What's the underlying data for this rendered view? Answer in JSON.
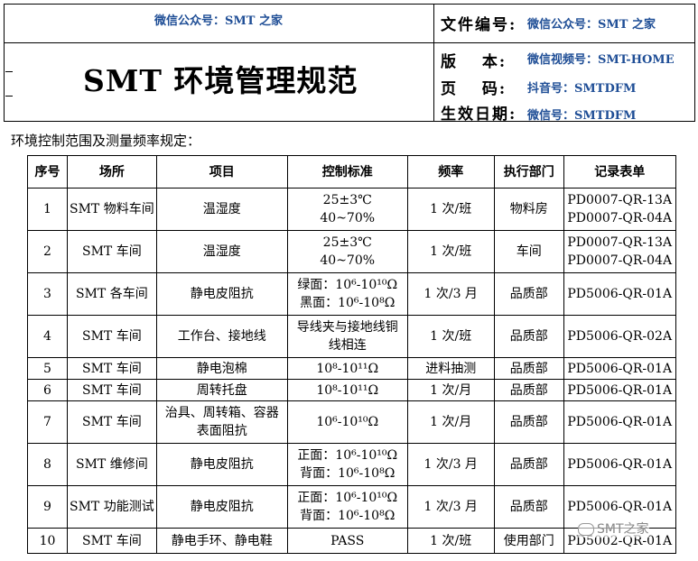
{
  "header": {
    "top_left_text": "微信公众号：SMT 之家",
    "title": "SMT 环境管理规范",
    "meta": [
      {
        "label": "文件编号:",
        "value": "微信公众号：SMT 之家"
      },
      {
        "label": "版　 本:",
        "value": "微信视频号：SMT-HOME"
      },
      {
        "label": "页　 码:",
        "value": "抖音号：SMTDFM"
      },
      {
        "label": "生效日期:",
        "value": "微信号：SMTDFM"
      }
    ]
  },
  "section_title": "环境控制范围及测量频率规定：",
  "table": {
    "headers": [
      "序号",
      "场所",
      "项目",
      "控制标准",
      "频率",
      "执行部门",
      "记录表单"
    ],
    "rows": [
      {
        "no": "1",
        "place": "SMT 物料车间",
        "item": "温湿度",
        "standard": [
          "25±3℃",
          "40~70%"
        ],
        "freq": "1 次/班",
        "dept": "物料房",
        "record": [
          "PD0007-QR-13A",
          "PD0007-QR-04A"
        ]
      },
      {
        "no": "2",
        "place": "SMT 车间",
        "item": "温湿度",
        "standard": [
          "25±3℃",
          "40~70%"
        ],
        "freq": "1 次/班",
        "dept": "车间",
        "record": [
          "PD0007-QR-13A",
          "PD0007-QR-04A"
        ]
      },
      {
        "no": "3",
        "place": "SMT 各车间",
        "item": "静电皮阻抗",
        "standard": [
          "绿面：10⁶-10¹⁰Ω",
          "黑面：10⁶-10⁸Ω"
        ],
        "freq": "1 次/3 月",
        "dept": "品质部",
        "record": [
          "PD5006-QR-01A"
        ]
      },
      {
        "no": "4",
        "place": "SMT 车间",
        "item": "工作台、接地线",
        "standard": [
          "导线夹与接地线铜",
          "线相连"
        ],
        "freq": "1 次/班",
        "dept": "品质部",
        "record": [
          "PD5006-QR-02A"
        ]
      },
      {
        "no": "5",
        "place": "SMT 车间",
        "item": "静电泡棉",
        "standard": [
          "10⁸-10¹¹Ω"
        ],
        "freq": "进料抽测",
        "dept": "品质部",
        "record": [
          "PD5006-QR-01A"
        ]
      },
      {
        "no": "6",
        "place": "SMT 车间",
        "item": "周转托盘",
        "standard": [
          "10⁸-10¹¹Ω"
        ],
        "freq": "1 次/月",
        "dept": "品质部",
        "record": [
          "PD5006-QR-01A"
        ]
      },
      {
        "no": "7",
        "place": "SMT 车间",
        "item": [
          "治具、周转箱、容器",
          "表面阻抗"
        ],
        "standard": [
          "10⁶-10¹⁰Ω"
        ],
        "freq": "1 次/月",
        "dept": "品质部",
        "record": [
          "PD5006-QR-01A"
        ]
      },
      {
        "no": "8",
        "place": "SMT 维修间",
        "item": "静电皮阻抗",
        "standard": [
          "正面：10⁶-10¹⁰Ω",
          "背面：10⁶-10⁸Ω"
        ],
        "freq": "1 次/3 月",
        "dept": "品质部",
        "record": [
          "PD5006-QR-01A"
        ]
      },
      {
        "no": "9",
        "place": "SMT 功能测试",
        "item": "静电皮阻抗",
        "standard": [
          "正面：10⁶-10¹⁰Ω",
          "背面：10⁶-10⁸Ω"
        ],
        "freq": "1 次/3 月",
        "dept": "品质部",
        "record": [
          "PD5006-QR-01A"
        ]
      },
      {
        "no": "10",
        "place": "SMT 车间",
        "item": "静电手环、静电鞋",
        "standard": [
          "PASS"
        ],
        "freq": "1 次/班",
        "dept": "使用部门",
        "record": [
          "PD5002-QR-01A"
        ]
      }
    ]
  },
  "watermark": "SMT之家"
}
